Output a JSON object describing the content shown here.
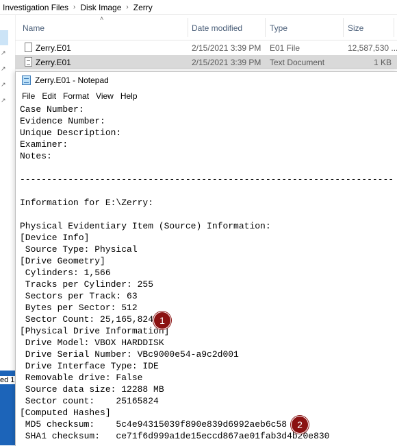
{
  "breadcrumb": [
    "Investigation Files",
    "Disk Image",
    "Zerry"
  ],
  "columns": {
    "name": "Name",
    "date_modified": "Date modified",
    "type": "Type",
    "size": "Size"
  },
  "files": [
    {
      "name": "Zerry.E01",
      "date_modified": "2/15/2021 3:39 PM",
      "type": "E01 File",
      "size": "12,587,530 ...",
      "icon": "file-icon",
      "selected": false
    },
    {
      "name": "Zerry.E01",
      "date_modified": "2/15/2021 3:39 PM",
      "type": "Text Document",
      "size": "1 KB",
      "icon": "text-document-icon",
      "selected": true
    }
  ],
  "status_fragment": "ed 1(",
  "notepad": {
    "title": "Zerry.E01 - Notepad",
    "menu": [
      "File",
      "Edit",
      "Format",
      "View",
      "Help"
    ],
    "lines": [
      "Case Number:",
      "Evidence Number:",
      "Unique Description:",
      "Examiner:",
      "Notes:",
      "",
      "----------------------------------------------------------------------",
      "",
      "Information for E:\\Zerry:",
      "",
      "Physical Evidentiary Item (Source) Information:",
      "[Device Info]",
      " Source Type: Physical",
      "[Drive Geometry]",
      " Cylinders: 1,566",
      " Tracks per Cylinder: 255",
      " Sectors per Track: 63",
      " Bytes per Sector: 512",
      " Sector Count: 25,165,824",
      "[Physical Drive Information]",
      " Drive Model: VBOX HARDDISK",
      " Drive Serial Number: VBc9000e54-a9c2d001",
      " Drive Interface Type: IDE",
      " Removable drive: False",
      " Source data size: 12288 MB",
      " Sector count:    25165824",
      "[Computed Hashes]",
      " MD5 checksum:    5c4e94315039f890e839d6992aeb6c58",
      " SHA1 checksum:   ce71f6d999a1de15eccd867ae01fab3d4b20e830"
    ]
  },
  "annotations": [
    "1",
    "2"
  ],
  "colors": {
    "badge": "#8b1212",
    "selected_row": "#d9d9d9",
    "taskbar": "#1c64b9",
    "header_text": "#4c607a"
  }
}
